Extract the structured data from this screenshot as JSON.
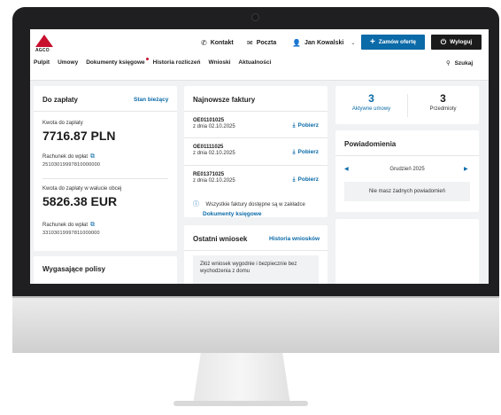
{
  "header": {
    "logo_text": "AGCO",
    "contact_label": "Kontakt",
    "mail_label": "Poczta",
    "user_name": "Jan Kowalski",
    "order_button": "Zamów ofertę",
    "logout_button": "Wyloguj",
    "search_label": "Szukaj"
  },
  "nav": [
    "Pulpit",
    "Umowy",
    "Dokumenty księgowe",
    "Historia rozliczeń",
    "Wnioski",
    "Aktualności"
  ],
  "to_pay": {
    "title": "Do zapłaty",
    "link": "Stan bieżący",
    "amount_label": "Kwota do zapłaty",
    "amount": "7716.87 PLN",
    "account_label": "Rachunek do wpłat",
    "account": "25103019997810000000",
    "amount_fx_label": "Kwota do zapłaty w walucie obcej",
    "amount_fx": "5826.38 EUR",
    "account_fx_label": "Rachunek do wpłat",
    "account_fx": "33103019997811000000"
  },
  "expiring": {
    "title": "Wygasające polisy"
  },
  "invoices": {
    "title": "Najnowsze faktury",
    "download_label": "Pobierz",
    "items": [
      {
        "number": "OE01101025",
        "date": "z dnia 02.10.2025"
      },
      {
        "number": "OE01111025",
        "date": "z dnia 02.10.2025"
      },
      {
        "number": "RE01371025",
        "date": "z dnia 02.10.2025"
      }
    ],
    "note": "Wszystkie faktury dostępne są w zakładce",
    "note_link": "Dokumenty księgowe"
  },
  "last_request": {
    "title": "Ostatni wniosek",
    "link": "Historia wniosków",
    "text": "Złóż wniosek wygodnie i bezpiecznie bez wychodzenia z domu"
  },
  "stats": {
    "active_count": "3",
    "active_label": "Aktywne umowy",
    "items_count": "3",
    "items_label": "Przedmioty"
  },
  "notifications": {
    "title": "Powiadomienia",
    "month": "Grudzień 2025",
    "empty": "Nie masz żadnych powiadomień"
  }
}
